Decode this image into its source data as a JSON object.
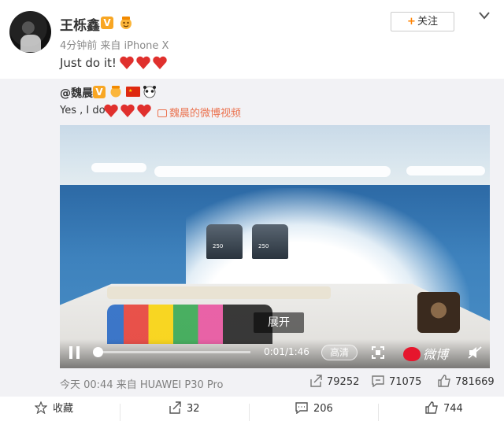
{
  "post": {
    "username": "王栎鑫",
    "verified_badge": "V",
    "meta": "4分钟前 来自 iPhone X",
    "text": "Just do it!",
    "follow_label": "关注",
    "follow_plus": "+"
  },
  "repost": {
    "username": "@魏晨",
    "verified_badge": "V",
    "text": "Yes , I do",
    "video_link": "魏晨的微博视频",
    "footer_time": "今天 00:44 来自 HUAWEI P30 Pro",
    "stats": {
      "reposts": "79252",
      "comments": "71075",
      "likes": "781669"
    }
  },
  "video": {
    "expand_label": "展开",
    "time": "0:01/1:46",
    "progress_fraction": 0.01,
    "quality_label": "高清",
    "brand_text": "微博",
    "engine_label": "250"
  },
  "actions": {
    "favorite": "收藏",
    "repost": "32",
    "comment": "206",
    "like": "744"
  },
  "colors": {
    "accent": "#ff8200",
    "link": "#eb7350",
    "heart": "#e0302d",
    "vbadge": "#f8a623"
  }
}
